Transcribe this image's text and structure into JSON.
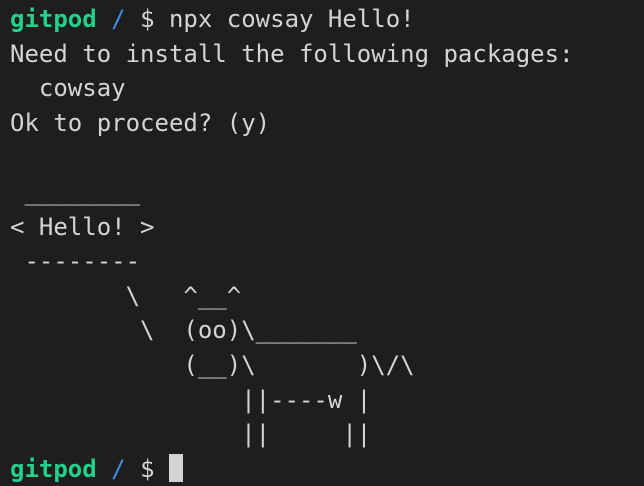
{
  "window": {
    "type": "terminal",
    "background": "#1e1e1e",
    "foreground": "#d4d4d4",
    "user_color": "#23d18b",
    "path_color": "#3b8eea"
  },
  "prompt": {
    "user": "gitpod",
    "path": "/",
    "symbol": "$"
  },
  "session": {
    "command": "npx cowsay Hello!",
    "output": [
      "Need to install the following packages:",
      "  cowsay",
      "Ok to proceed? (y)",
      "",
      " ________",
      "< Hello! >",
      " --------",
      "        \\   ^__^",
      "         \\  (oo)\\_______",
      "            (__)\\       )\\/\\",
      "                ||----w |",
      "                ||     ||"
    ],
    "current_input": ""
  }
}
